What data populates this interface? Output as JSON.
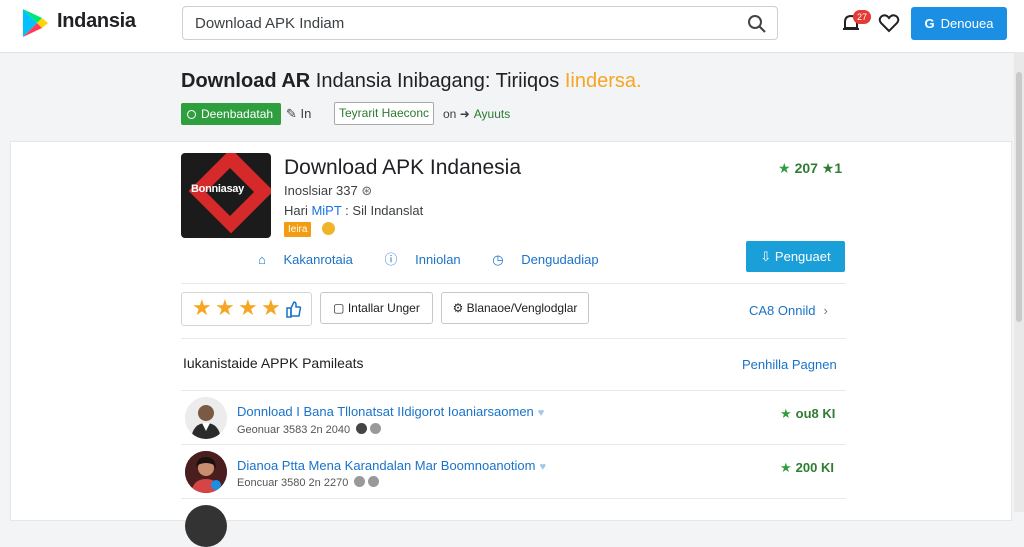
{
  "header": {
    "brand": "Indansia",
    "search_value": "Download APK Indiam",
    "notification_count": "27",
    "action_button": "Denouea"
  },
  "page": {
    "title_bold": "Download AR",
    "title_rest": " Indansia Inibagang: Tiriiqos ",
    "title_highlight": "Iindersa.",
    "chip_green": "Deenbadatah",
    "crumb_a": "In",
    "chip_outline": "Teyrarit Haeconc",
    "crumb_b_prefix": "on",
    "crumb_b_link": "Ayuuts"
  },
  "app": {
    "icon_text": "Bonniasay",
    "title": "Download APK Indanesia",
    "meta1": "Inoslsiar 337",
    "meta2_prefix": "Hari ",
    "meta2_blue": "MiPT",
    "meta2_suffix": " : Sil Indanslat",
    "tag": "Ieira",
    "rating": "207 ★1",
    "links": [
      "Kakanrotaia",
      "Inniolan",
      "Dengudadiap"
    ],
    "install_button": "Penguaet"
  },
  "actions": {
    "stars_filled": 4,
    "btn1": "Intallar Unger",
    "btn2": "Blanaoe/Venglodglar",
    "more_link": "CA8 Onnild"
  },
  "section": {
    "title": "Iukanistaide APPK Pamileats",
    "link": "Penhilla Pagnen"
  },
  "reviews": [
    {
      "title": "Donnload I Bana Tllonatsat IIdigorot Ioaniarsaomen",
      "sub": "Geonuar 3583 2n 2040",
      "rating": "ou8 KI"
    },
    {
      "title": "Dianoa Ptta Mena Karandalan Mar Boomnoanotiom",
      "sub": "Eoncuar 3580 2n 2270",
      "rating": "200 KI"
    }
  ],
  "colors": {
    "accent": "#1a8fe3",
    "green": "#2e9e3e",
    "orange": "#f5a623"
  }
}
